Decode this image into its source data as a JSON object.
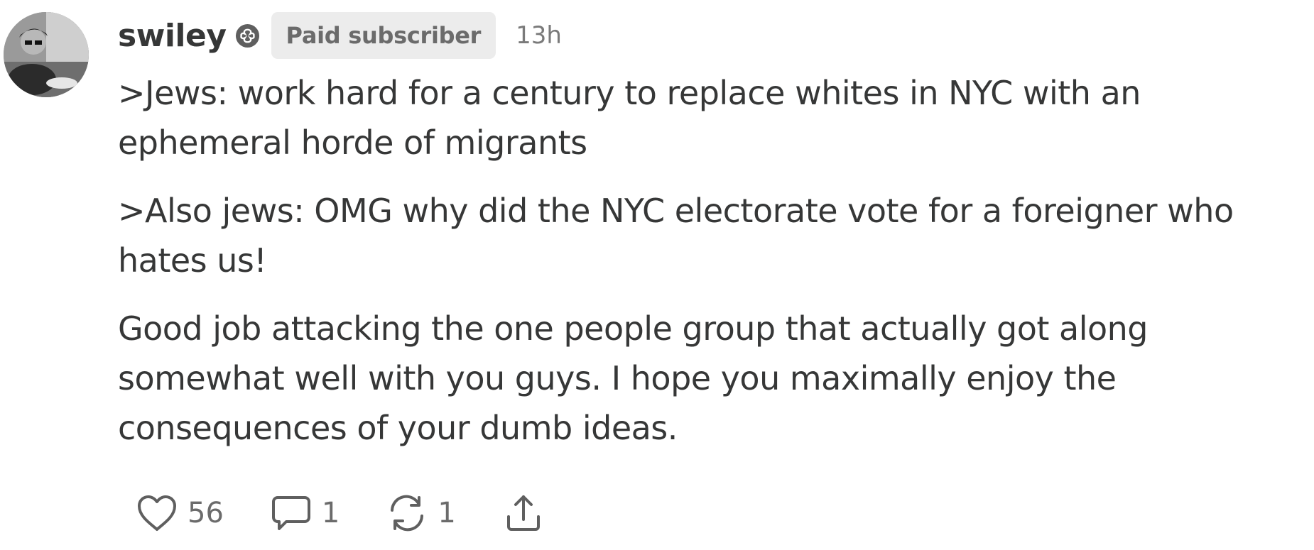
{
  "comment": {
    "username": "swiley",
    "badge": "Paid subscriber",
    "time": "13h",
    "paragraphs": [
      ">Jews: work hard for a century to replace whites in NYC with an ephemeral horde of migrants",
      ">Also jews: OMG why did the NYC electorate vote for a foreigner who hates us!",
      "Good job attacking the one people group that actually got along somewhat well with you guys. I hope you maximally enjoy the consequences of your dumb ideas."
    ]
  },
  "actions": {
    "likes": "56",
    "replies": "1",
    "restacks": "1"
  },
  "icons": {
    "like": "heart-icon",
    "reply": "speech-bubble-icon",
    "restack": "restack-arrows-icon",
    "share": "share-upload-icon",
    "verified": "subscriber-badge-icon"
  },
  "colors": {
    "text": "#363737",
    "muted": "#6b6b6b",
    "badge_bg": "#ececec"
  }
}
